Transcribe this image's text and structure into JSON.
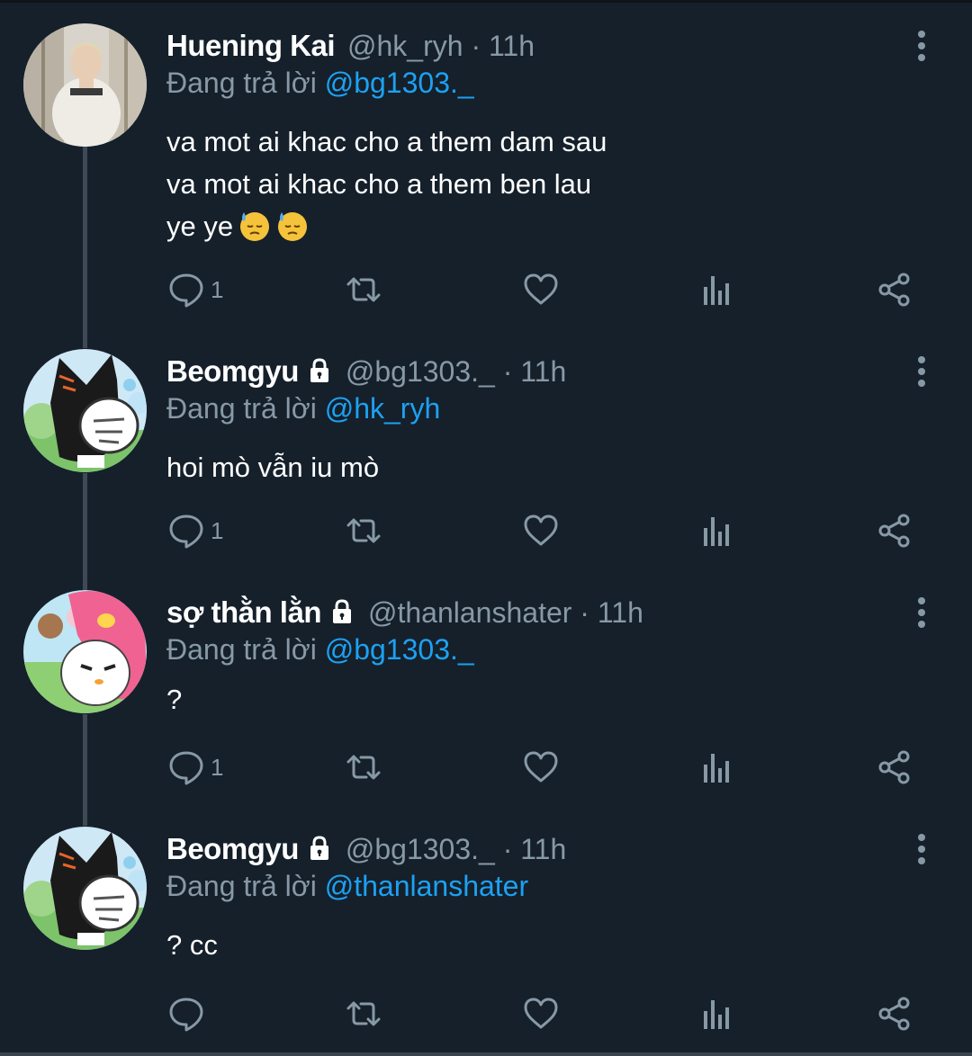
{
  "tweets": [
    {
      "name": "Huening Kai",
      "locked": false,
      "handle": "@hk_ryh · 11h",
      "reply_prefix": "Đang trả lời",
      "reply_mention": "@bg1303._",
      "lines": [
        "va mot ai khac cho a them dam sau",
        "va mot ai khac cho a them ben lau",
        "ye ye"
      ],
      "emoji": [
        "downcast-face-with-sweat",
        "downcast-face-with-sweat"
      ],
      "reply_count": "1"
    },
    {
      "name": "Beomgyu",
      "locked": true,
      "handle": "@bg1303._ · 11h",
      "reply_prefix": "Đang trả lời",
      "reply_mention": "@hk_ryh",
      "lines": [
        "hoi mò vẫn iu mò"
      ],
      "reply_count": "1"
    },
    {
      "name": "sợ thằn lằn",
      "locked": true,
      "handle": "@thanlanshater · 11h",
      "reply_prefix": "Đang trả lời",
      "reply_mention": "@bg1303._",
      "lines": [
        "?"
      ],
      "reply_count": "1"
    },
    {
      "name": "Beomgyu",
      "locked": true,
      "handle": "@bg1303._ · 11h",
      "reply_prefix": "Đang trả lời",
      "reply_mention": "@thanlanshater",
      "lines": [
        "? cc"
      ],
      "reply_count": ""
    }
  ],
  "icons": {
    "reply": "speech-bubble-icon",
    "retweet": "retweet-arrows-icon",
    "like": "heart-icon",
    "analytics": "bar-chart-icon",
    "share": "share-nodes-icon",
    "more": "vertical-ellipsis-icon",
    "lock": "lock-icon"
  },
  "colors": {
    "background": "#15202b",
    "mention": "#1da1f2",
    "secondary_text": "#8899a6",
    "thread_line": "#3d4a55"
  }
}
